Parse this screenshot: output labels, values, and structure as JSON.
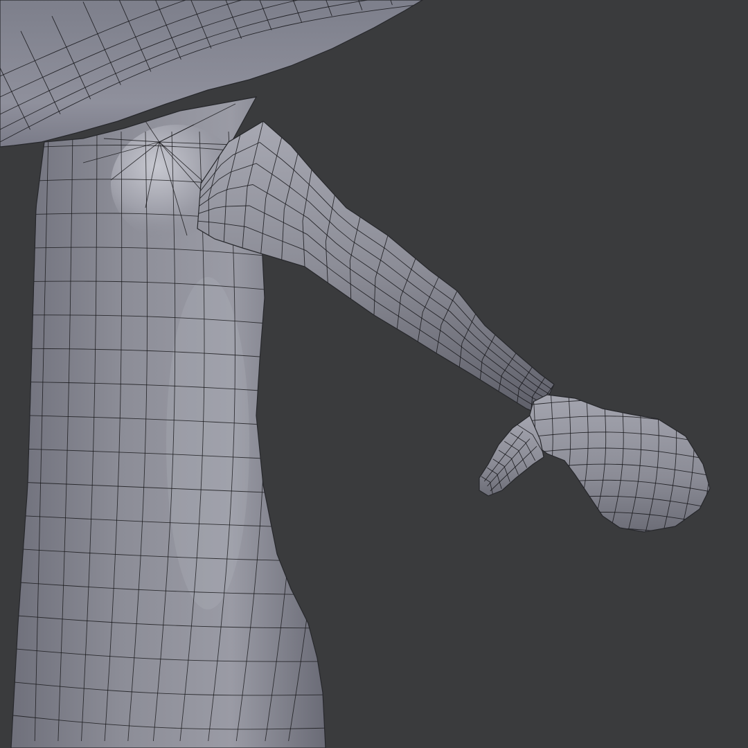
{
  "viewport": {
    "name": "3d-viewport",
    "shading": "solid",
    "overlay": "wireframe",
    "background_color": "#3a3b3d",
    "mesh_base_color": "#8a8c96",
    "mesh_highlight_color": "#c9cad2",
    "mesh_shadow_color": "#5b5c66",
    "edge_color": "#141417"
  },
  "mesh": {
    "object": "mushroom-character",
    "parts": [
      "cap",
      "stem-body",
      "arm",
      "hand",
      "thumb"
    ]
  }
}
